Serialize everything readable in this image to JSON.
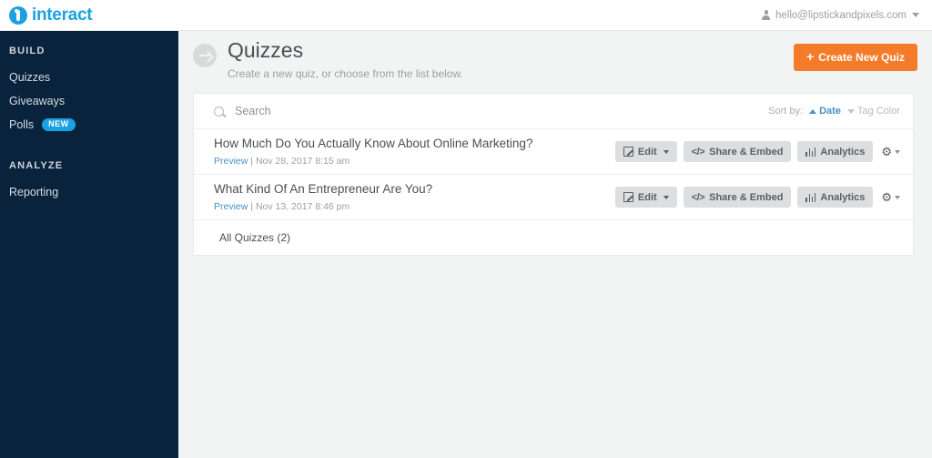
{
  "topbar": {
    "brand_name": "interact",
    "brand_icon": "interact-logo-icon",
    "account_email": "hello@lipstickandpixels.com",
    "account_icon": "person-icon",
    "account_caret_icon": "chevron-down-icon"
  },
  "sidebar": {
    "sections": [
      {
        "title": "BUILD",
        "items": [
          {
            "label": "Quizzes",
            "badge": null
          },
          {
            "label": "Giveaways",
            "badge": null
          },
          {
            "label": "Polls",
            "badge": "NEW"
          }
        ]
      },
      {
        "title": "ANALYZE",
        "items": [
          {
            "label": "Reporting",
            "badge": null
          }
        ]
      }
    ]
  },
  "page": {
    "title": "Quizzes",
    "subtitle": "Create a new quiz, or choose from the list below.",
    "back_icon": "arrow-right-circle-icon",
    "create_button": {
      "label": "Create New Quiz",
      "plus": "+",
      "color": "#f47b29"
    }
  },
  "search": {
    "placeholder": "Search",
    "value": "",
    "icon": "search-icon"
  },
  "sort": {
    "label": "Sort by:",
    "options": [
      {
        "label": "Date",
        "state": "active",
        "direction": "asc",
        "color": "#4a90c4"
      },
      {
        "label": "Tag Color",
        "state": "inactive",
        "direction": "desc",
        "color": "#b4b9bd"
      }
    ]
  },
  "quizzes": {
    "rows": [
      {
        "title": "How Much Do You Actually Know About Online Marketing?",
        "preview_label": "Preview",
        "separator": "|",
        "date": "Nov 28, 2017 8:15 am",
        "actions": {
          "edit": "Edit",
          "share": "Share & Embed",
          "analytics": "Analytics",
          "gear": "⚙"
        }
      },
      {
        "title": "What Kind Of An Entrepreneur Are You?",
        "preview_label": "Preview",
        "separator": "|",
        "date": "Nov 13, 2017 8:46 pm",
        "actions": {
          "edit": "Edit",
          "share": "Share & Embed",
          "analytics": "Analytics",
          "gear": "⚙"
        }
      }
    ],
    "footer_label": "All Quizzes (2)"
  },
  "icons": {
    "edit": "pencil-icon",
    "share": "code-brackets-icon",
    "analytics": "bar-chart-icon",
    "gear": "gear-icon"
  }
}
